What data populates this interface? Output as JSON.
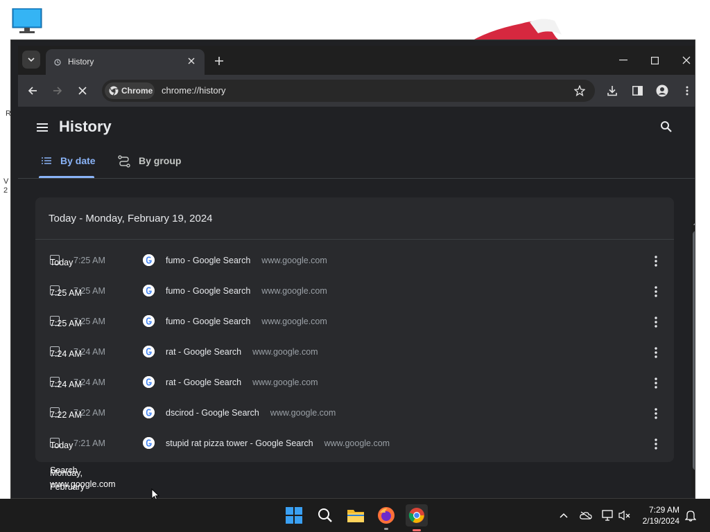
{
  "browser": {
    "tab_title": "History",
    "omnibox_chip": "Chrome",
    "url": "chrome://history"
  },
  "history": {
    "title": "History",
    "tabs": [
      {
        "label": "By date",
        "active": true
      },
      {
        "label": "By group",
        "active": false
      }
    ],
    "date_header": "Today - Monday, February 19, 2024",
    "entries": [
      {
        "time": "7:25 AM",
        "title": "fumo - Google Search",
        "domain": "www.google.com"
      },
      {
        "time": "7:25 AM",
        "title": "fumo - Google Search",
        "domain": "www.google.com"
      },
      {
        "time": "7:25 AM",
        "title": "fumo - Google Search",
        "domain": "www.google.com"
      },
      {
        "time": "7:24 AM",
        "title": "rat - Google Search",
        "domain": "www.google.com"
      },
      {
        "time": "7:24 AM",
        "title": "rat - Google Search",
        "domain": "www.google.com"
      },
      {
        "time": "7:22 AM",
        "title": "dscirod - Google Search",
        "domain": "www.google.com"
      },
      {
        "time": "7:21 AM",
        "title": "stupid rat pizza tower - Google Search",
        "domain": "www.google.com"
      }
    ]
  },
  "overlay": {
    "labels": [
      "Today",
      "7:25 AM",
      "7:25 AM",
      "7:24 AM",
      "7:24 AM",
      "7:22 AM",
      "Today",
      "Search",
      "Monday,",
      "www.google.com",
      "February"
    ]
  },
  "taskbar": {
    "time": "7:29 AM",
    "date": "2/19/2024"
  },
  "colors": {
    "accent": "#8ab4f8",
    "page_bg": "#202124",
    "card_bg": "#292a2d",
    "taskbar_bg": "#1c1c1c"
  }
}
